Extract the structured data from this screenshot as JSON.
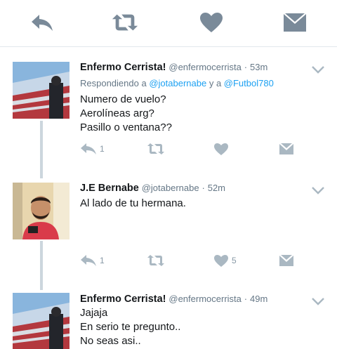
{
  "top_actions": {
    "reply_icon": "reply-icon",
    "retweet_icon": "retweet-icon",
    "like_icon": "heart-icon",
    "dm_icon": "envelope-icon",
    "icon_color": "#7a8a99"
  },
  "tweets": [
    {
      "name": "Enfermo Cerrista!",
      "handle": "@enfermocerrista",
      "dot": "·",
      "time": "53m",
      "reply_prefix": "Respondiendo a",
      "reply_user1": "@jotabernabe",
      "reply_and": "y a",
      "reply_user2": "@Futbol780",
      "lines": [
        "Numero de vuelo?",
        "Aerolíneas arg?",
        "Pasillo o ventana??"
      ],
      "reply_count": "1",
      "like_count": ""
    },
    {
      "name": "J.E Bernabe",
      "handle": "@jotabernabe",
      "dot": "·",
      "time": "52m",
      "lines": [
        "Al lado de tu hermana."
      ],
      "reply_count": "1",
      "like_count": "5"
    },
    {
      "name": "Enfermo Cerrista!",
      "handle": "@enfermocerrista",
      "dot": "·",
      "time": "49m",
      "lines": [
        "Jajaja",
        "En serio te pregunto..",
        "No seas asi.."
      ]
    }
  ],
  "colors": {
    "text": "#14171a",
    "secondary": "#657786",
    "link": "#1da1f2",
    "action": "#aab8c2",
    "divider": "#e1e8ed"
  }
}
